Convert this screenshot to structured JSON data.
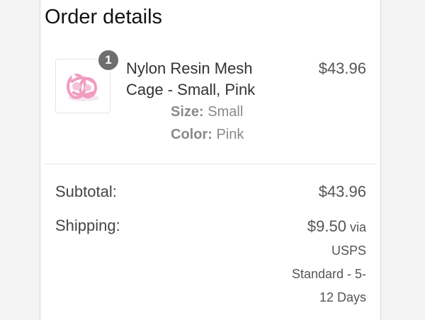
{
  "order": {
    "title": "Order details",
    "item": {
      "quantity": "1",
      "name": "Nylon Resin Mesh Cage - Small, Pink",
      "price": "$43.96",
      "size_label": "Size:",
      "size_value": "Small",
      "color_label": "Color:",
      "color_value": "Pink",
      "image_icon": "product-thumbnail-pink-cage",
      "image_color": "#f4a7c6"
    },
    "subtotal_label": "Subtotal:",
    "subtotal_value": "$43.96",
    "shipping_label": "Shipping:",
    "shipping_price": "$9.50",
    "shipping_via": "via",
    "shipping_carrier": "USPS",
    "shipping_method_1": "Standard - 5-",
    "shipping_method_2": "12 Days"
  }
}
